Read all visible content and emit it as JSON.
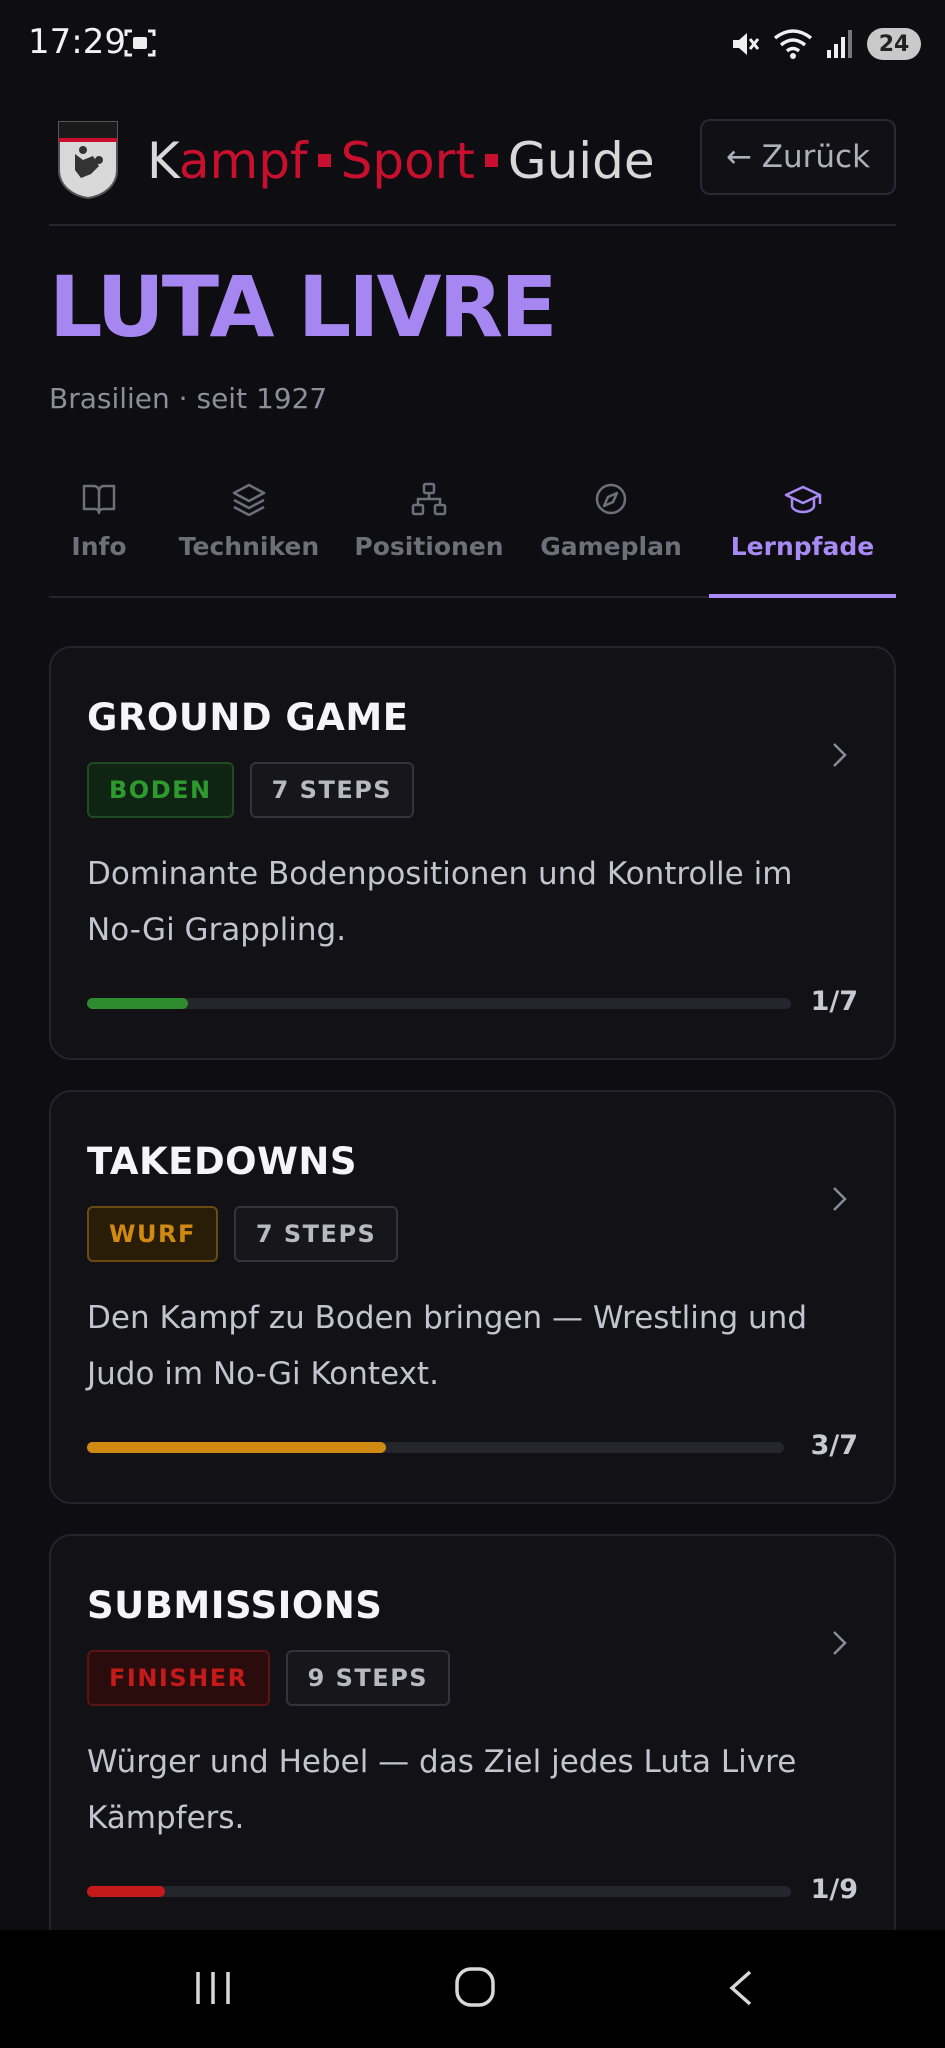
{
  "status": {
    "time": "17:29",
    "battery": "24"
  },
  "header": {
    "brand_k": "K",
    "brand_ampf": "ampf",
    "brand_sport": "Sport",
    "brand_guide": "Guide",
    "back_label": "← Zurück"
  },
  "page": {
    "title": "LUTA LIVRE",
    "subtitle": "Brasilien · seit 1927"
  },
  "tabs": [
    {
      "label": "Info",
      "icon": "book-icon"
    },
    {
      "label": "Techniken",
      "icon": "layers-icon"
    },
    {
      "label": "Positionen",
      "icon": "hierarchy-icon"
    },
    {
      "label": "Gameplan",
      "icon": "compass-icon"
    },
    {
      "label": "Lernpfade",
      "icon": "graduation-cap-icon",
      "active": true
    }
  ],
  "paths": [
    {
      "title": "GROUND GAME",
      "category": "BODEN",
      "steps": "7 STEPS",
      "description": "Dominante Bodenpositionen und Kontrolle im No-Gi Grappling.",
      "progress_label": "1/7",
      "progress": 0.143,
      "color": "#2e8b2e"
    },
    {
      "title": "TAKEDOWNS",
      "category": "WURF",
      "steps": "7 STEPS",
      "description": "Den Kampf zu Boden bringen — Wrestling und Judo im No-Gi Kontext.",
      "progress_label": "3/7",
      "progress": 0.429,
      "color": "#d08a12"
    },
    {
      "title": "SUBMISSIONS",
      "category": "FINISHER",
      "steps": "9 STEPS",
      "description": "Würger und Hebel — das Ziel jedes Luta Livre Kämpfers.",
      "progress_label": "1/9",
      "progress": 0.111,
      "color": "#c41a1a"
    }
  ]
}
